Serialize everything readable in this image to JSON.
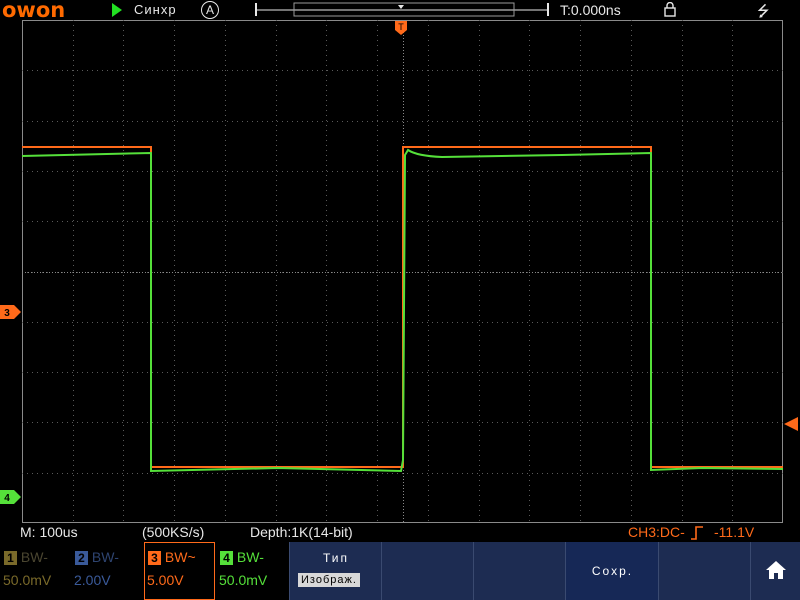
{
  "topbar": {
    "brand": "owon",
    "run_state": "Синхр",
    "trigger_mode_badge": "A",
    "time_offset": "T:0.000ns",
    "usb_icon": "usb-icon",
    "lock_icon": "lock-icon"
  },
  "markers": {
    "trigger_position": "T",
    "ch3": "3",
    "ch4": "4"
  },
  "status": {
    "timebase": "M: 100us",
    "sample_rate": "(500KS/s)",
    "depth": "Depth:1K(14-bit)",
    "trigger_info": "CH3:DC-",
    "trigger_level": "-11.1V"
  },
  "channels": [
    {
      "num": "1",
      "bw": "BW-",
      "volt": "50.0mV",
      "color": "#7a6a2a"
    },
    {
      "num": "2",
      "bw": "BW-",
      "volt": "2.00V",
      "color": "#3a5a9a"
    },
    {
      "num": "3",
      "bw": "BW~",
      "volt": "5.00V",
      "color": "#ff6a1a"
    },
    {
      "num": "4",
      "bw": "BW-",
      "volt": "50.0mV",
      "color": "#55e03a"
    }
  ],
  "menu": {
    "type_label": "Тип",
    "type_value": "Изображ.",
    "save_label": "Сохр.",
    "home_icon": "home-icon"
  },
  "colors": {
    "ch3": "#ff6a1a",
    "ch4": "#55e03a",
    "grid": "#5a5a5a",
    "menu_bg": "#1d2c52"
  }
}
